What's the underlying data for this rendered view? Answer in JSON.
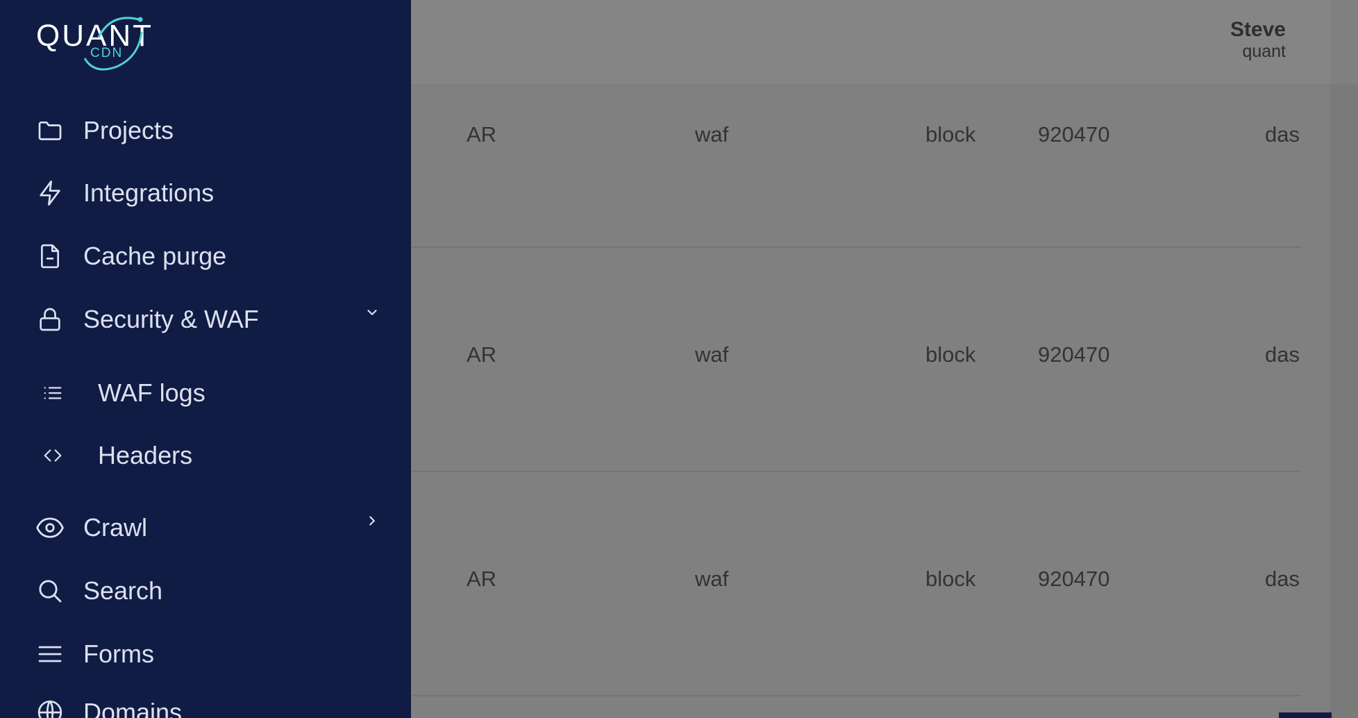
{
  "brand": {
    "logo_main": "QUANT",
    "logo_sub": "CDN"
  },
  "header": {
    "user_name": "Steve",
    "user_org": "quant"
  },
  "sidebar": {
    "items": [
      {
        "label": "Projects",
        "icon": "folder-icon"
      },
      {
        "label": "Integrations",
        "icon": "lightning-icon"
      },
      {
        "label": "Cache purge",
        "icon": "document-minus-icon"
      },
      {
        "label": "Security & WAF",
        "icon": "lock-icon",
        "expanded": true
      },
      {
        "label": "WAF logs",
        "icon": "list-icon",
        "sub": true
      },
      {
        "label": "Headers",
        "icon": "code-icon",
        "sub": true
      },
      {
        "label": "Crawl",
        "icon": "eye-icon",
        "expanded": false
      },
      {
        "label": "Search",
        "icon": "search-icon"
      },
      {
        "label": "Forms",
        "icon": "menu-lines-icon"
      },
      {
        "label": "Domains",
        "icon": "globe-icon"
      }
    ]
  },
  "logs": {
    "rows": [
      {
        "country": "AR",
        "type": "waf",
        "action": "block",
        "rule": "920470",
        "host": "das"
      },
      {
        "country": "AR",
        "type": "waf",
        "action": "block",
        "rule": "920470",
        "host": "das"
      },
      {
        "country": "AR",
        "type": "waf",
        "action": "block",
        "rule": "920470",
        "host": "das"
      }
    ]
  },
  "colors": {
    "sidebar_bg": "#111c45",
    "overlay_bg": "#808080",
    "accent": "#4fd1d9"
  }
}
